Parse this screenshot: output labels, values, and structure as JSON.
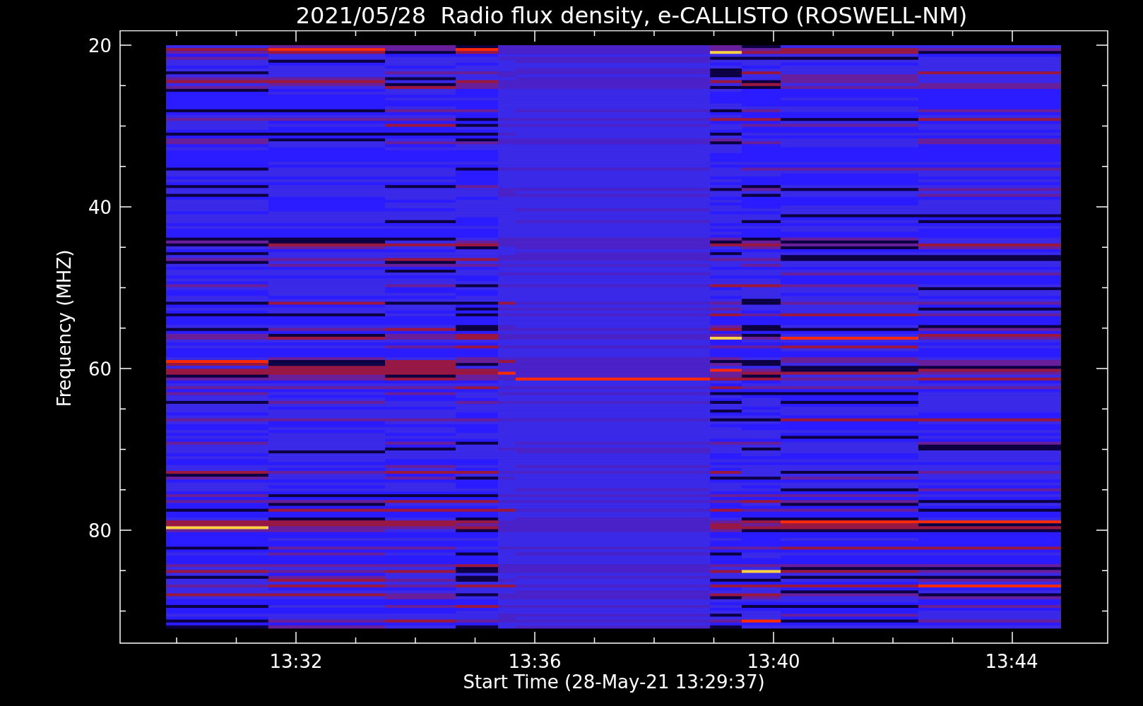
{
  "title": "2021/05/28  Radio flux density, e-CALLISTO (ROSWELL-NM)",
  "y_axis": {
    "label": "Frequency (MHZ)",
    "ticks": [
      "20",
      "40",
      "60",
      "80"
    ]
  },
  "x_axis": {
    "label": "Start Time (28-May-21 13:29:37)",
    "ticks": [
      "13:32",
      "13:36",
      "13:40",
      "13:44"
    ]
  }
}
